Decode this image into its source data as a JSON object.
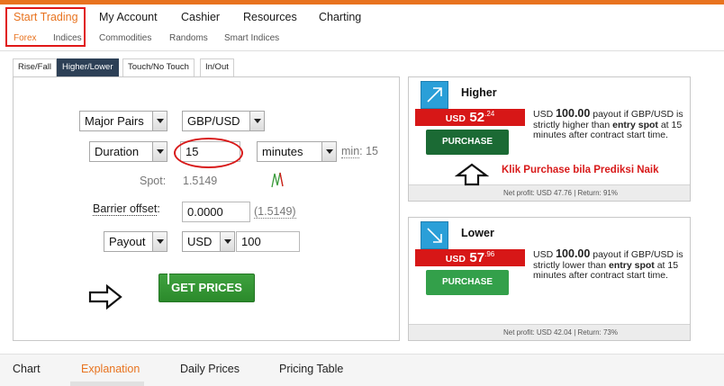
{
  "nav": {
    "items": [
      {
        "label": "Start Trading",
        "active": true
      },
      {
        "label": "My Account",
        "active": false
      },
      {
        "label": "Cashier",
        "active": false
      },
      {
        "label": "Resources",
        "active": false
      },
      {
        "label": "Charting",
        "active": false
      }
    ],
    "sub_items": [
      {
        "label": "Forex",
        "active": true
      },
      {
        "label": "Indices",
        "active": false
      },
      {
        "label": "Commodities",
        "active": false
      },
      {
        "label": "Randoms",
        "active": false
      },
      {
        "label": "Smart Indices",
        "active": false
      }
    ]
  },
  "contract_tabs": [
    {
      "label": "Rise/Fall",
      "active": false
    },
    {
      "label": "Higher/Lower",
      "active": true
    },
    {
      "label": "Touch/No Touch",
      "active": false
    },
    {
      "label": "In/Out",
      "active": false
    }
  ],
  "form": {
    "market": "Major Pairs",
    "symbol": "GBP/USD",
    "duration_type": "Duration",
    "duration_value": "15",
    "duration_unit": "minutes",
    "min_label": "min",
    "min_value": ": 15",
    "spot_label": "Spot:",
    "spot_value": "1.5149",
    "barrier_label": "Barrier offset",
    "barrier_colon": ":",
    "barrier_value": "0.0000",
    "barrier_ref": "(1.5149)",
    "payout_type": "Payout",
    "currency": "USD",
    "amount": "100",
    "get_prices_label": "GET PRICES"
  },
  "higher": {
    "title": "Higher",
    "price_currency": "USD",
    "price_main": "52",
    "price_sup": ".24",
    "purchase_label": "PURCHASE",
    "desc_currency": "USD",
    "desc_amount": "100.00",
    "desc_payout": "payout if",
    "desc_rest": "GBP/USD is strictly higher than",
    "desc_entry": "entry spot",
    "desc_tail": "at 15 minutes after contract start time.",
    "footer": "Net profit: USD 47.76 | Return: 91%",
    "annotation": "Klik Purchase bila Prediksi Naik"
  },
  "lower": {
    "title": "Lower",
    "price_currency": "USD",
    "price_main": "57",
    "price_sup": ".96",
    "purchase_label": "PURCHASE",
    "desc_currency": "USD",
    "desc_amount": "100.00",
    "desc_payout": "payout if",
    "desc_rest": "GBP/USD is strictly lower than",
    "desc_entry": "entry spot",
    "desc_tail": "at 15 minutes after contract start time.",
    "footer": "Net profit: USD 42.04 | Return: 73%"
  },
  "bottom_tabs": [
    {
      "label": "Chart",
      "active": false
    },
    {
      "label": "Explanation",
      "active": true
    },
    {
      "label": "Daily Prices",
      "active": false
    },
    {
      "label": "Pricing Table",
      "active": false
    }
  ],
  "colors": {
    "accent": "#e8731f",
    "highlight_red": "#d81a1a",
    "purchase_green": "#1b6a34",
    "icon_blue": "#2a9fd8"
  }
}
